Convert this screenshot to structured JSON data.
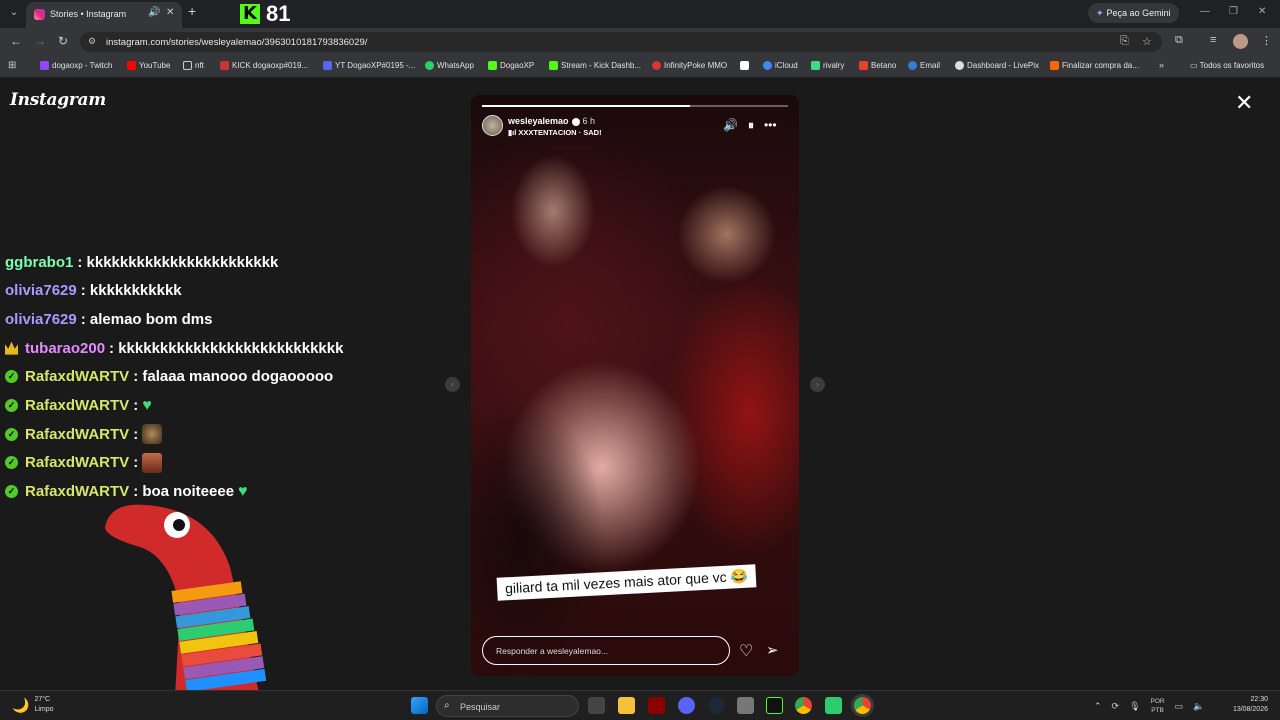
{
  "browser": {
    "tab_title": "Stories • Instagram",
    "overlay_kick_count": "81",
    "gemini_label": "Peça ao Gemini",
    "url": "instagram.com/stories/wesleyalemao/3963010181793836029/",
    "bookmarks": [
      "dogaoxp - Twitch",
      "YouTube",
      "nft",
      "KICK dogaoxp#019...",
      "YT DogaoXP#0195 -...",
      "WhatsApp",
      "DogaoXP",
      "Stream - Kick Dashb...",
      "InfinityPoke MMO",
      "iCloud",
      "rivalry",
      "Betano",
      "Email",
      "Dashboard - LivePix",
      "Finalizar compra da..."
    ],
    "all_favorites": "Todos os favoritos",
    "colors": {
      "kick_green": "#53fc18",
      "dark_bg": "#1a1a1a"
    }
  },
  "instagram": {
    "logo": "Instagram",
    "story": {
      "username": "wesleyalemao",
      "time_ago": "6 h",
      "music": "XXXTENTACION · SAD!",
      "progress": 0.68,
      "caption": "giliard ta mil vezes mais ator que vc 😂",
      "reply_placeholder": "Responder a wesleyalemao..."
    }
  },
  "chat": [
    {
      "user": "ggbrabo1",
      "color": "#7dffb0",
      "badge": "",
      "text": ": kkkkkkkkkkkkkkkkkkkkkkk"
    },
    {
      "user": "olivia7629",
      "color": "#a99bff",
      "badge": "",
      "text": ": kkkkkkkkkkk"
    },
    {
      "user": "olivia7629",
      "color": "#a99bff",
      "badge": "",
      "text": ": alemao bom dms"
    },
    {
      "user": "tubarao200",
      "color": "#e58bff",
      "badge": "crown",
      "text": ": kkkkkkkkkkkkkkkkkkkkkkkkkkk"
    },
    {
      "user": "RafaxdWARTV",
      "color": "#d8e56b",
      "badge": "check",
      "text": ": falaaa manooo dogaooooo"
    },
    {
      "user": "RafaxdWARTV",
      "color": "#d8e56b",
      "badge": "check",
      "text": ":"
    },
    {
      "user": "RafaxdWARTV",
      "color": "#d8e56b",
      "badge": "check",
      "text": ":"
    },
    {
      "user": "RafaxdWARTV",
      "color": "#d8e56b",
      "badge": "check",
      "text": ":"
    },
    {
      "user": "RafaxdWARTV",
      "color": "#d8e56b",
      "badge": "check",
      "text": ": boa noiteeee"
    }
  ],
  "taskbar": {
    "weather_temp": "27°C",
    "weather_desc": "Limpo",
    "search_placeholder": "Pesquisar",
    "lang": "POR",
    "lang_sub": "PTB",
    "time": "22:30",
    "date": "13/08/2026"
  }
}
